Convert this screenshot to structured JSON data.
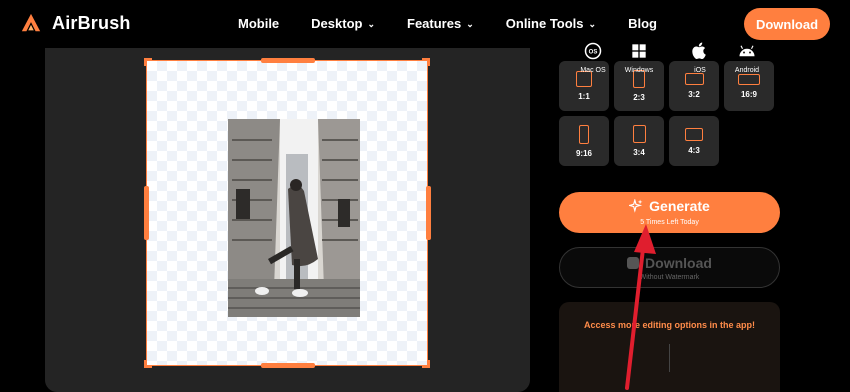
{
  "brand": {
    "name": "AirBrush",
    "accent": "#ff7f3f"
  },
  "nav": {
    "links": [
      {
        "label": "Mobile",
        "dropdown": false
      },
      {
        "label": "Desktop",
        "dropdown": true
      },
      {
        "label": "Features",
        "dropdown": true
      },
      {
        "label": "Online Tools",
        "dropdown": true
      },
      {
        "label": "Blog",
        "dropdown": false
      }
    ],
    "download_label": "Download"
  },
  "ratios": [
    "1:1",
    "2:3",
    "3:2",
    "16:9",
    "9:16",
    "3:4",
    "4:3"
  ],
  "generate": {
    "label": "Generate",
    "sub": "5 Times Left Today"
  },
  "download_no_watermark": {
    "label": "Download",
    "sub": "Without Watermark"
  },
  "app_promo": {
    "title": "Access more editing options in the app!",
    "platforms": [
      {
        "label": "Mac OS",
        "icon": "macos-icon"
      },
      {
        "label": "Windows",
        "icon": "windows-icon"
      },
      {
        "label": "iOS",
        "icon": "apple-icon"
      },
      {
        "label": "Android",
        "icon": "android-icon"
      }
    ]
  }
}
